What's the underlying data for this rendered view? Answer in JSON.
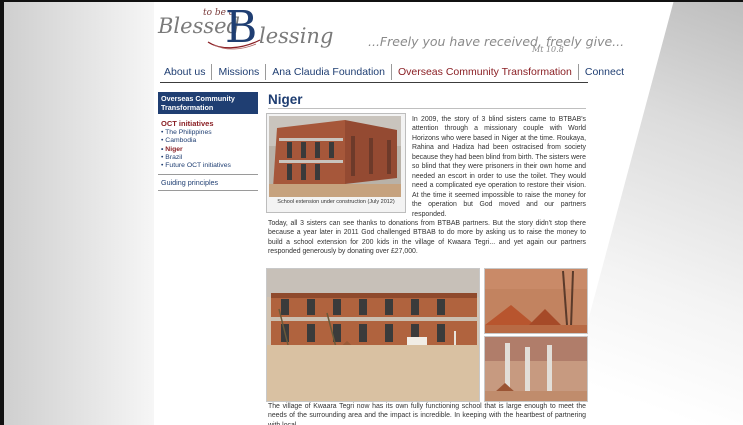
{
  "header": {
    "logo_word1": "Blessed",
    "logo_small": "to be a",
    "logo_letter": "B",
    "logo_word2": "lessing",
    "tagline": "...Freely you have received, freely give...",
    "tagline_ref": "Mt 10.8"
  },
  "nav": {
    "items": [
      {
        "label": "About us"
      },
      {
        "label": "Missions"
      },
      {
        "label": "Ana Claudia Foundation"
      },
      {
        "label": "Overseas Community Transformation"
      },
      {
        "label": "Connect"
      }
    ]
  },
  "sidebar": {
    "heading": "Overseas Community Transformation",
    "subheading": "OCT initiatives",
    "items": [
      {
        "label": "The Philippines"
      },
      {
        "label": "Cambodia"
      },
      {
        "label": "Niger"
      },
      {
        "label": "Brazil"
      },
      {
        "label": "Future OCT initiatives"
      }
    ],
    "guiding_link": "Guiding principles"
  },
  "main": {
    "title": "Niger",
    "figure_caption": "School extension under construction (July 2012)",
    "para1": "In 2009, the story of 3 blind sisters came to BTBAB's attention through a missionary couple with World Horizons who were based in Niger at the time. Roukaya, Rahina and Hadiza had been ostracised from society because they had been blind from birth. The sisters were so blind that they were prisoners in their own home and needed an escort in order to use the toilet. They would need a complicated eye operation to restore their vision. At the time it seemed impossible to raise the money for the operation but God moved and our partners responded.",
    "para2": "Today, all 3 sisters can see thanks to donations from BTBAB partners. But the story didn't stop there because a year later in 2011 God challenged BTBAB to do more by asking us to raise the money to build a school extension for 200 kids in the village of Kwaara Tegri... and yet again our partners responded generously by donating over £27,000.",
    "para3": "The village of Kwaara Tegri now has its own fully functioning school that is large enough to meet the needs of the surrounding area and the impact is incredible. In keeping with the heartbest of partnering with local"
  },
  "colors": {
    "brand_blue": "#1f3e72",
    "active_red": "#8a1f24"
  }
}
